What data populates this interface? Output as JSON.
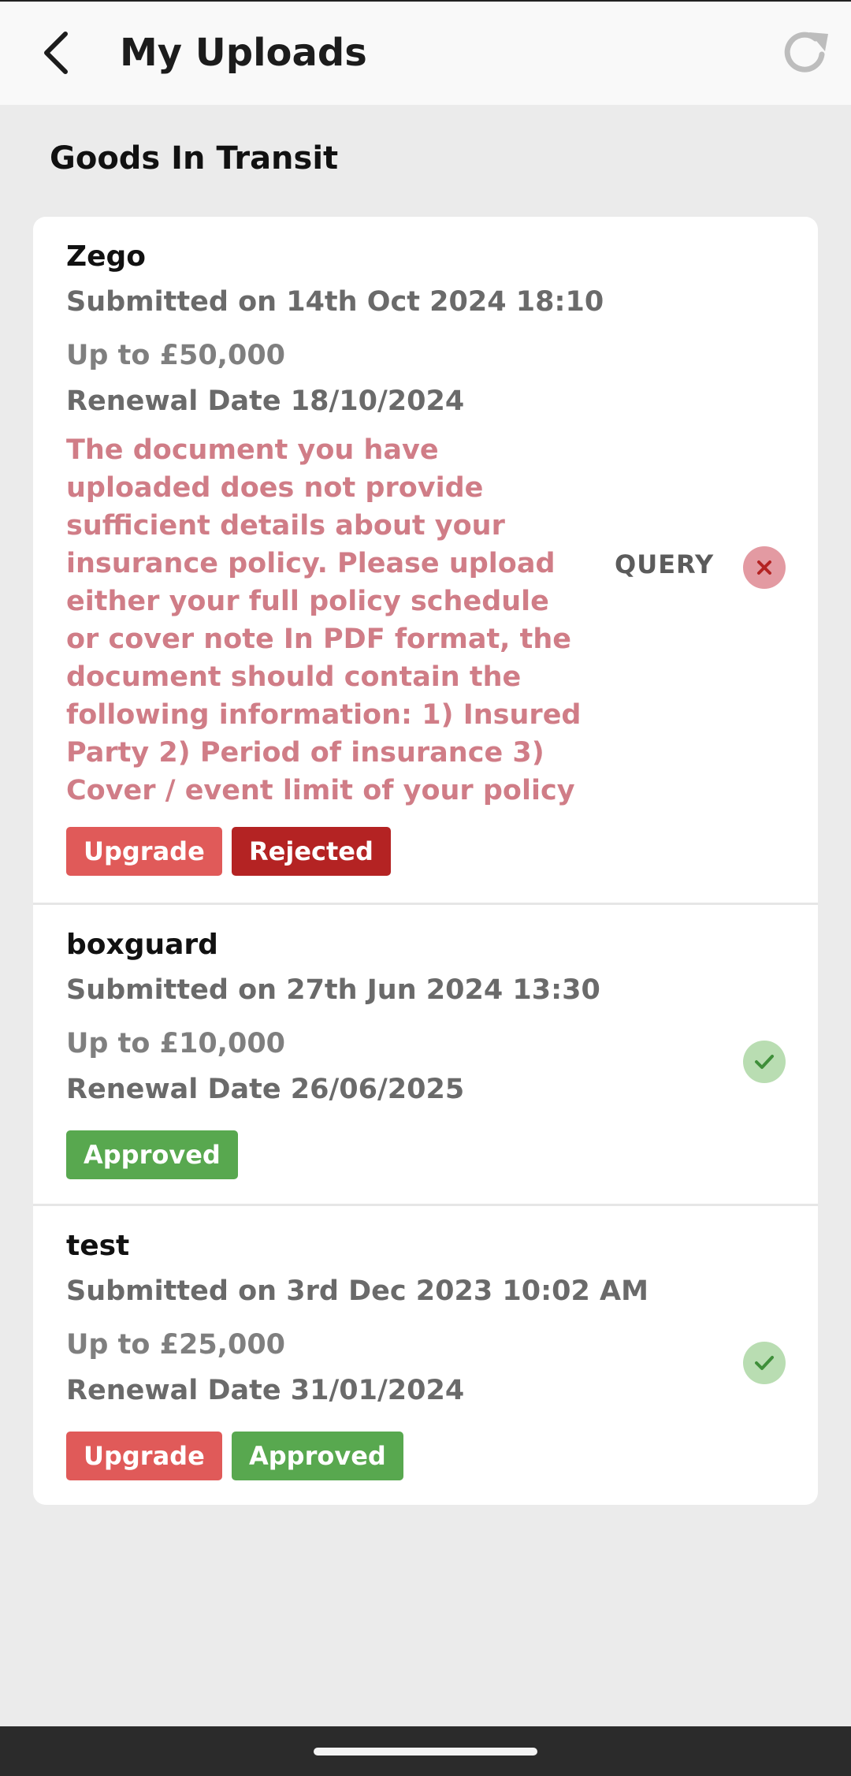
{
  "header": {
    "title": "My Uploads",
    "back_icon": "chevron-left-icon",
    "refresh_icon": "refresh-icon"
  },
  "section": {
    "title": "Goods In Transit"
  },
  "uploads": [
    {
      "name": "Zego",
      "submitted": "Submitted on 14th Oct 2024 18:10",
      "limit": "Up to £50,000",
      "renewal": "Renewal Date 18/10/2024",
      "message": "The document you have uploaded does not provide sufficient details about your insurance policy. Please upload either your full policy schedule or cover note In PDF format, the document should contain the following information: 1) Insured Party 2) Period of insurance 3) Cover / event limit of your policy",
      "status_label": "QUERY",
      "status_icon": "cross-icon",
      "badges": [
        "Upgrade",
        "Rejected"
      ]
    },
    {
      "name": "boxguard",
      "submitted": "Submitted on 27th Jun 2024 13:30",
      "limit": "Up to £10,000",
      "renewal": "Renewal Date 26/06/2025",
      "status_icon": "check-icon",
      "badges": [
        "Approved"
      ]
    },
    {
      "name": "test",
      "submitted": "Submitted on 3rd Dec 2023 10:02 AM",
      "limit": "Up to £25,000",
      "renewal": "Renewal Date 31/01/2024",
      "status_icon": "check-icon",
      "badges": [
        "Upgrade",
        "Approved"
      ]
    }
  ],
  "colors": {
    "upgrade": "#e05a59",
    "rejected": "#b42323",
    "approved": "#58a84f",
    "query_text": "#d07d87",
    "background": "#ebebeb"
  }
}
